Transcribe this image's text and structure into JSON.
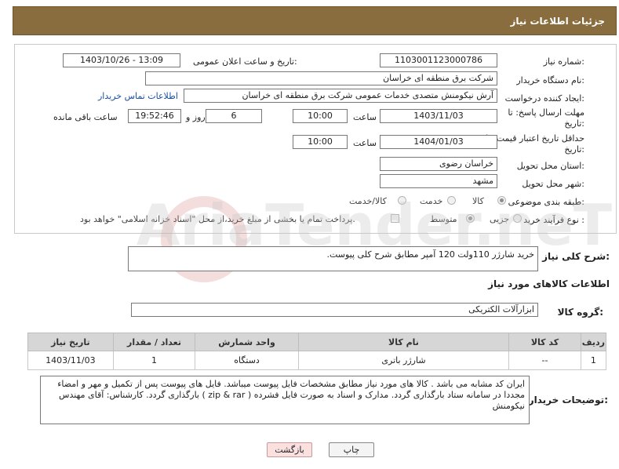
{
  "header": {
    "title": "جزئیات اطلاعات نیاز"
  },
  "form": {
    "need_number_label": "شماره نیاز:",
    "need_number": "1103001123000786",
    "announce_label": "تاریخ و ساعت اعلان عمومی:",
    "announce_value": "1403/10/26 - 13:09",
    "buyer_org_label": "نام دستگاه خریدار:",
    "buyer_org": "شرکت برق منطقه ای خراسان",
    "requester_label": "ایجاد کننده درخواست:",
    "requester": "آرش نیکومنش متصدی خدمات عمومی شرکت برق منطقه ای خراسان",
    "contact_link": "اطلاعات تماس خریدار",
    "deadline_label_1": "مهلت ارسال پاسخ: تا",
    "deadline_label_2": "تاریخ:",
    "deadline_date": "1403/11/03",
    "time_label": "ساعت",
    "deadline_time": "10:00",
    "days_value": "6",
    "days_label": "روز و",
    "remaining_time": "19:52:46",
    "remaining_label": "ساعت باقی مانده",
    "validity_label_1": "حداقل تاریخ اعتبار قیمت: تا",
    "validity_label_2": "تاریخ:",
    "validity_date": "1404/01/03",
    "validity_time": "10:00",
    "province_label": "استان محل تحویل:",
    "province": "خراسان رضوی",
    "city_label": "شهر محل تحویل:",
    "city": "مشهد",
    "category_label": "طبقه بندی موضوعی:",
    "category_options": [
      "کالا",
      "خدمت",
      "کالا/خدمت"
    ],
    "purchase_type_label": "نوع فرآیند خرید :",
    "purchase_options": [
      "جزیی",
      "متوسط"
    ],
    "payment_note": "پرداخت تمام یا بخشی از مبلغ خرید،از محل \"اسناد خزانه اسلامی\" خواهد بود."
  },
  "summary": {
    "label": "شرح کلی نیاز:",
    "value": "خرید شارژر  110ولت  120 آمپر مطابق شرح کلی پیوست."
  },
  "goods": {
    "section_title": "اطلاعات کالاهای مورد نیاز",
    "group_label": "گروه کالا:",
    "group_value": "ابزارآلات الکتریکی",
    "columns": [
      "ردیف",
      "کد کالا",
      "نام کالا",
      "واحد شمارش",
      "تعداد / مقدار",
      "تاریخ نیاز"
    ],
    "rows": [
      [
        "1",
        "--",
        "شارژر باتری",
        "دستگاه",
        "1",
        "1403/11/03"
      ]
    ]
  },
  "buyer_notes": {
    "label": "توضیحات خریدار:",
    "value": "ایران کد مشابه می باشد . کالا های مورد نیاز مطابق مشخصات فایل پیوست میباشد. فایل های پیوست پس از تکمیل و مهر و امضاء مجددا در سامانه ستاد بارگذاری گردد. مدارک و اسناد به صورت فایل فشرده ( zip & rar ) بارگذاری گردد. کارشناس: آقای مهندس نیکومنش"
  },
  "buttons": {
    "print": "چاپ",
    "back": "بازگشت"
  },
  "watermark": "AriaTender.neT"
}
